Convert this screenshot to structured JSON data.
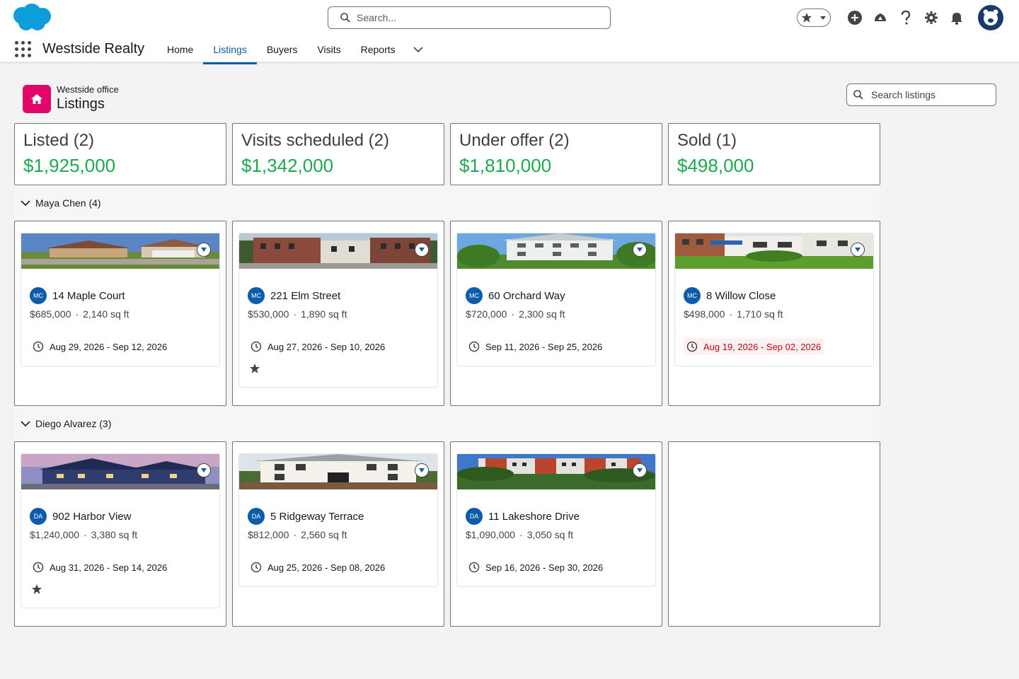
{
  "global_search": {
    "placeholder": "Search..."
  },
  "app": {
    "name": "Westside Realty"
  },
  "nav": {
    "tabs": [
      {
        "label": "Home",
        "active": false
      },
      {
        "label": "Listings",
        "active": true
      },
      {
        "label": "Buyers",
        "active": false
      },
      {
        "label": "Visits",
        "active": false
      },
      {
        "label": "Reports",
        "active": false
      }
    ]
  },
  "page": {
    "breadcrumb": "Westside office",
    "title": "Listings",
    "search_placeholder": "Search listings"
  },
  "colors": {
    "accent": "#0b5cab",
    "money": "#1ea84f",
    "object_icon": "#e3066a",
    "overdue": "#ba0517"
  },
  "summary": [
    {
      "label": "Listed (2)",
      "amount": "$1,925,000"
    },
    {
      "label": "Visits scheduled (2)",
      "amount": "$1,342,000"
    },
    {
      "label": "Under offer (2)",
      "amount": "$1,810,000"
    },
    {
      "label": "Sold (1)",
      "amount": "$498,000"
    }
  ],
  "groups": [
    {
      "label": "Maya Chen (4)",
      "cards": [
        {
          "initials": "MC",
          "title": "14 Maple Court",
          "price": "$685,000",
          "area": "2,140 sq ft",
          "dates": "Aug 29, 2026 - Sep 12, 2026",
          "overdue": false,
          "starred": false,
          "image": "ranch"
        },
        {
          "initials": "MC",
          "title": "221 Elm Street",
          "price": "$530,000",
          "area": "1,890 sq ft",
          "dates": "Aug 27, 2026 - Sep 10, 2026",
          "overdue": false,
          "starred": true,
          "image": "brick"
        },
        {
          "initials": "MC",
          "title": "60 Orchard Way",
          "price": "$720,000",
          "area": "2,300 sq ft",
          "dates": "Sep 11, 2026 - Sep 25, 2026",
          "overdue": false,
          "starred": false,
          "image": "white-house"
        },
        {
          "initials": "MC",
          "title": "8 Willow Close",
          "price": "$498,000",
          "area": "1,710 sq ft",
          "dates": "Aug 19, 2026 - Sep 02, 2026",
          "overdue": true,
          "starred": false,
          "image": "apartments"
        }
      ]
    },
    {
      "label": "Diego Alvarez (3)",
      "cards": [
        {
          "initials": "DA",
          "title": "902 Harbor View",
          "price": "$1,240,000",
          "area": "3,380 sq ft",
          "dates": "Aug 31, 2026 - Sep 14, 2026",
          "overdue": false,
          "starred": true,
          "image": "dusk"
        },
        {
          "initials": "DA",
          "title": "5 Ridgeway Terrace",
          "price": "$812,000",
          "area": "2,560 sq ft",
          "dates": "Aug 25, 2026 - Sep 08, 2026",
          "overdue": false,
          "starred": false,
          "image": "colonial"
        },
        {
          "initials": "DA",
          "title": "11 Lakeshore Drive",
          "price": "$1,090,000",
          "area": "3,050 sq ft",
          "dates": "Sep 16, 2026 - Sep 30, 2026",
          "overdue": false,
          "starred": false,
          "image": "riverside"
        }
      ]
    }
  ]
}
